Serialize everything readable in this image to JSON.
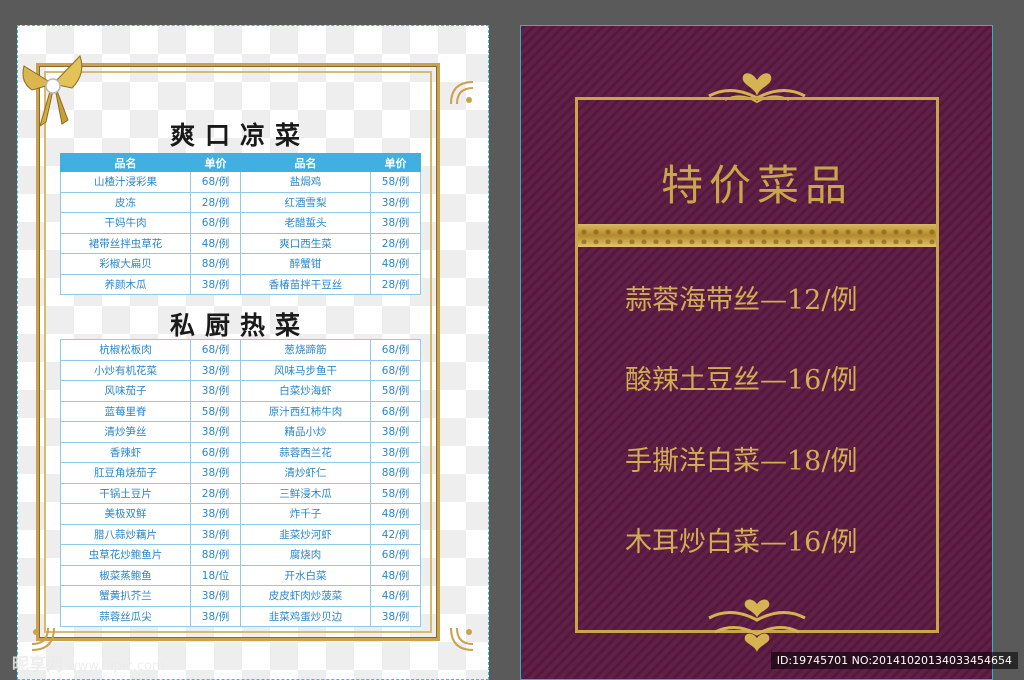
{
  "left_menu": {
    "cold_title": "爽口凉菜",
    "hot_title": "私厨热菜",
    "headers": [
      "品名",
      "单价",
      "品名",
      "单价"
    ],
    "cold_rows": [
      [
        "山楂汁浸彩果",
        "68/例",
        "盐焗鸡",
        "58/例"
      ],
      [
        "皮冻",
        "28/例",
        "红酒雪梨",
        "38/例"
      ],
      [
        "干妈牛肉",
        "68/例",
        "老醋蜇头",
        "38/例"
      ],
      [
        "裙带丝拌虫草花",
        "48/例",
        "爽口西生菜",
        "28/例"
      ],
      [
        "彩椒大扁贝",
        "88/例",
        "醉蟹钳",
        "48/例"
      ],
      [
        "养颜木瓜",
        "38/例",
        "香椿苗拌干豆丝",
        "28/例"
      ]
    ],
    "hot_rows": [
      [
        "杭椒松板肉",
        "68/例",
        "葱烧蹄筋",
        "68/例"
      ],
      [
        "小炒有机花菜",
        "38/例",
        "风味马步鱼干",
        "68/例"
      ],
      [
        "风味茄子",
        "38/例",
        "白菜炒海虾",
        "58/例"
      ],
      [
        "蓝莓里脊",
        "58/例",
        "原汁西红柿牛肉",
        "68/例"
      ],
      [
        "清炒笋丝",
        "38/例",
        "精品小炒",
        "38/例"
      ],
      [
        "香辣虾",
        "68/例",
        "蒜蓉西兰花",
        "38/例"
      ],
      [
        "肛豆角烧茄子",
        "38/例",
        "清炒虾仁",
        "88/例"
      ],
      [
        "干锅土豆片",
        "28/例",
        "三鲜浸木瓜",
        "58/例"
      ],
      [
        "美极双鲜",
        "38/例",
        "炸千子",
        "48/例"
      ],
      [
        "腊八蒜炒藕片",
        "38/例",
        "韭菜炒河虾",
        "42/例"
      ],
      [
        "虫草花炒鲍鱼片",
        "88/例",
        "腐烧肉",
        "68/例"
      ],
      [
        "椒菜蒸鲍鱼",
        "18/位",
        "开水白菜",
        "48/例"
      ],
      [
        "蟹黄扒芥兰",
        "38/例",
        "皮皮虾肉炒菠菜",
        "48/例"
      ],
      [
        "蒜蓉丝瓜尖",
        "38/例",
        "韭菜鸡蛋炒贝边",
        "38/例"
      ]
    ]
  },
  "right_poster": {
    "title": "特价菜品",
    "dishes": [
      "蒜蓉海带丝—12/例",
      "酸辣土豆丝—16/例",
      "手撕洋白菜—18/例",
      "木耳炒白菜—16/例"
    ]
  },
  "watermarks": {
    "logo_text": "昵享网",
    "url": "www.nipic.com",
    "id_text": "ID:19745701 NO:20141020134033454654"
  },
  "colors": {
    "table_header": "#3fb0e0",
    "table_text": "#2a86c8",
    "gold": "#caa64a",
    "poster_bg": "#5e1c44"
  }
}
